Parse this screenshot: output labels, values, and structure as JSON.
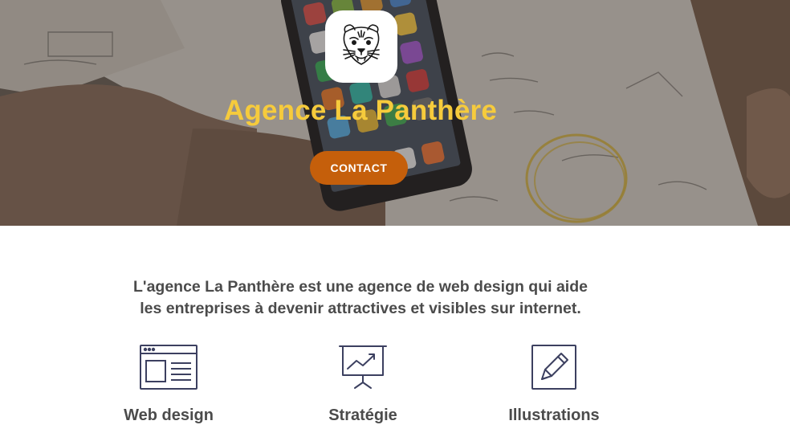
{
  "hero": {
    "title": "Agence La Panthère",
    "contact_label": "CONTACT",
    "logo_icon": "panther-head-icon"
  },
  "intro": {
    "line1": "L'agence La Panthère est une agence de web design qui aide",
    "line2": "les entreprises à devenir attractives et visibles sur internet."
  },
  "services": [
    {
      "label": "Web design",
      "icon": "browser-layout-icon"
    },
    {
      "label": "Stratégie",
      "icon": "presentation-chart-icon"
    },
    {
      "label": "Illustrations",
      "icon": "pencil-square-icon"
    }
  ],
  "colors": {
    "title": "#f6cb3c",
    "button": "#c55f0b",
    "text": "#4b4b4b",
    "icons": "#3c4060"
  }
}
